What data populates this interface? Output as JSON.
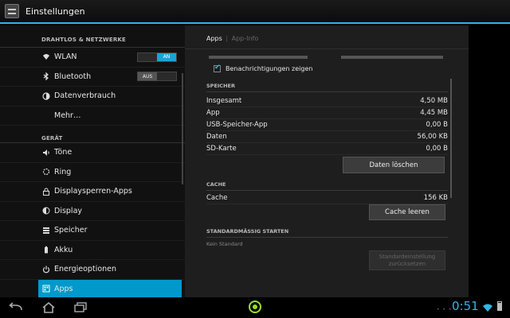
{
  "actionbar": {
    "title": "Einstellungen",
    "icon": "settings-app-icon"
  },
  "sidebar": {
    "sections": [
      {
        "header": "DRAHTLOS & NETZWERKE",
        "items": [
          {
            "label": "WLAN",
            "icon": "wifi-icon",
            "toggle": {
              "state": "on",
              "on_label": "AN",
              "off_label": ""
            }
          },
          {
            "label": "Bluetooth",
            "icon": "bluetooth-icon",
            "toggle": {
              "state": "off",
              "on_label": "",
              "off_label": "AUS"
            }
          },
          {
            "label": "Datenverbrauch",
            "icon": "data-usage-icon"
          },
          {
            "label": "Mehr…",
            "icon": ""
          }
        ]
      },
      {
        "header": "GERÄT",
        "items": [
          {
            "label": "Töne",
            "icon": "sound-icon"
          },
          {
            "label": "Ring",
            "icon": "ring-icon"
          },
          {
            "label": "Displaysperren-Apps",
            "icon": "lock-apps-icon"
          },
          {
            "label": "Display",
            "icon": "display-icon"
          },
          {
            "label": "Speicher",
            "icon": "storage-icon"
          },
          {
            "label": "Akku",
            "icon": "battery-icon"
          },
          {
            "label": "Energieoptionen",
            "icon": "power-icon"
          },
          {
            "label": "Apps",
            "icon": "apps-icon",
            "selected": true
          }
        ]
      }
    ]
  },
  "detail": {
    "tabs": {
      "active": "Apps",
      "separator": "|",
      "inactive": "App-Info"
    },
    "notifications_label": "Benachrichtigungen zeigen",
    "notifications_checked": true,
    "storage": {
      "header": "SPEICHER",
      "rows": [
        {
          "label": "Insgesamt",
          "value": "4,50 MB"
        },
        {
          "label": "App",
          "value": "4,45 MB"
        },
        {
          "label": "USB-Speicher-App",
          "value": "0,00 B"
        },
        {
          "label": "Daten",
          "value": "56,00 KB"
        },
        {
          "label": "SD-Karte",
          "value": "0,00 B"
        }
      ],
      "clear_data_button": "Daten löschen"
    },
    "cache": {
      "header": "CACHE",
      "row": {
        "label": "Cache",
        "value": "156 KB"
      },
      "clear_cache_button": "Cache leeren"
    },
    "defaults": {
      "header": "STANDARDMÄSSIG STARTEN",
      "status": "Kein Standard",
      "reset_button_line1": "Standardeinstellung",
      "reset_button_line2": "zurücksetzen"
    }
  },
  "navbar": {
    "back_icon": "back-icon",
    "home_icon": "home-icon",
    "recents_icon": "recents-icon",
    "clock": "0:51",
    "accent_color": "#33b5e5"
  }
}
